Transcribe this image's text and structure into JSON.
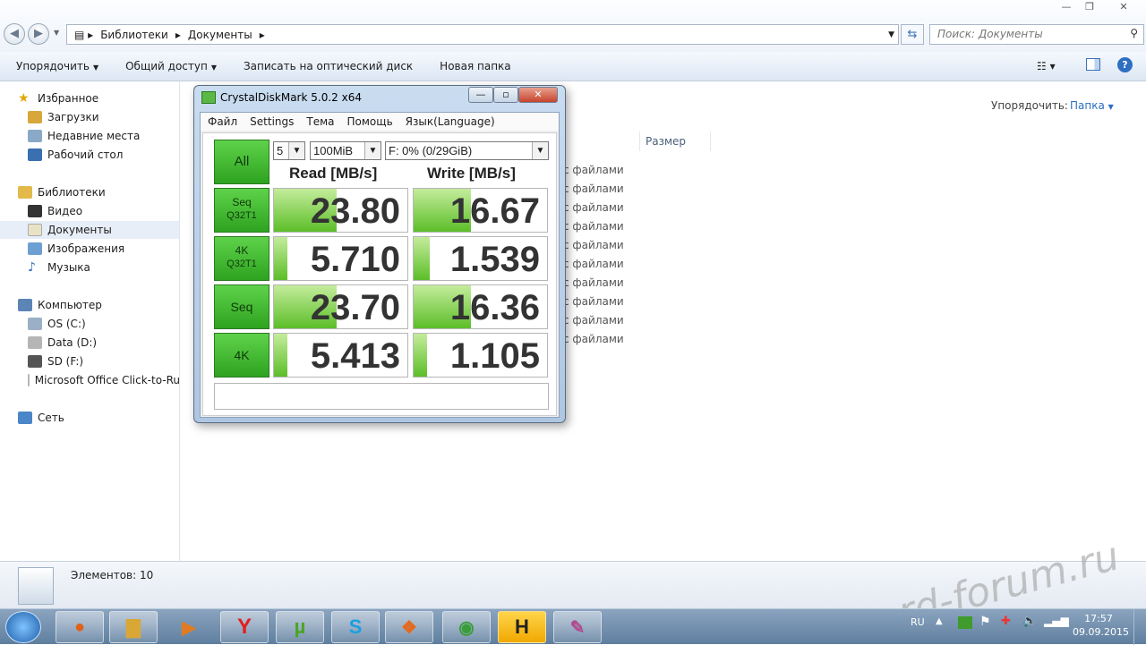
{
  "address": {
    "crumbs": [
      "Библиотеки",
      "Документы"
    ],
    "search_placeholder": "Поиск: Документы"
  },
  "toolbar": {
    "organize": "Упорядочить",
    "share": "Общий доступ",
    "burn": "Записать на оптический диск",
    "new_folder": "Новая папка"
  },
  "nav": {
    "favorites": "Избранное",
    "downloads": "Загрузки",
    "recent": "Недавние места",
    "desktop": "Рабочий стол",
    "libraries": "Библиотеки",
    "video": "Видео",
    "documents": "Документы",
    "images": "Изображения",
    "music": "Музыка",
    "computer": "Компьютер",
    "drive_c": "OS (C:)",
    "drive_d": "Data (D:)",
    "drive_f": "SD (F:)",
    "office": "Microsoft Office Click-to-Ru",
    "network": "Сеть"
  },
  "content": {
    "arrange_label": "Упорядочить:",
    "arrange_value": "Папка",
    "size_header": "Размер",
    "rows": [
      "с файлами",
      "с файлами",
      "с файлами",
      "с файлами",
      "с файлами",
      "с файлами",
      "с файлами",
      "с файлами",
      "с файлами",
      "с файлами"
    ]
  },
  "status": {
    "items": "Элементов: 10"
  },
  "watermark": "rd-forum.ru",
  "tray": {
    "lang": "RU",
    "time": "17:57",
    "date": "09.09.2015"
  },
  "cdm": {
    "title": "CrystalDiskMark 5.0.2 x64",
    "menu": [
      "Файл",
      "Settings",
      "Тема",
      "Помощь",
      "Язык(Language)"
    ],
    "all_button": "All",
    "count": "5",
    "size": "100MiB",
    "drive": "F: 0% (0/29GiB)",
    "read_header": "Read [MB/s]",
    "write_header": "Write [MB/s]",
    "tests": [
      {
        "label1": "Seq",
        "label2": "Q32T1",
        "read": "23.80",
        "write": "16.67",
        "read_fill": 0.47,
        "write_fill": 0.43
      },
      {
        "label1": "4K",
        "label2": "Q32T1",
        "read": "5.710",
        "write": "1.539",
        "read_fill": 0.1,
        "write_fill": 0.12
      },
      {
        "label1": "Seq",
        "label2": "",
        "read": "23.70",
        "write": "16.36",
        "read_fill": 0.47,
        "write_fill": 0.43
      },
      {
        "label1": "4K",
        "label2": "",
        "read": "5.413",
        "write": "1.105",
        "read_fill": 0.1,
        "write_fill": 0.1
      }
    ]
  }
}
